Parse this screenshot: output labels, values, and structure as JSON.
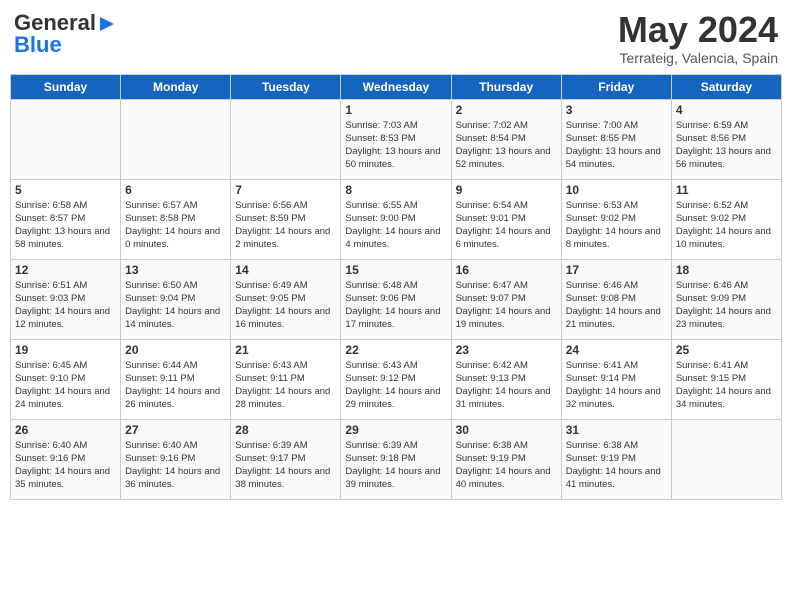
{
  "header": {
    "logo_general": "General",
    "logo_blue": "Blue",
    "month_title": "May 2024",
    "location": "Terrateig, Valencia, Spain"
  },
  "days_of_week": [
    "Sunday",
    "Monday",
    "Tuesday",
    "Wednesday",
    "Thursday",
    "Friday",
    "Saturday"
  ],
  "weeks": [
    [
      {
        "day": "",
        "sunrise": "",
        "sunset": "",
        "daylight": ""
      },
      {
        "day": "",
        "sunrise": "",
        "sunset": "",
        "daylight": ""
      },
      {
        "day": "",
        "sunrise": "",
        "sunset": "",
        "daylight": ""
      },
      {
        "day": "1",
        "sunrise": "Sunrise: 7:03 AM",
        "sunset": "Sunset: 8:53 PM",
        "daylight": "Daylight: 13 hours and 50 minutes."
      },
      {
        "day": "2",
        "sunrise": "Sunrise: 7:02 AM",
        "sunset": "Sunset: 8:54 PM",
        "daylight": "Daylight: 13 hours and 52 minutes."
      },
      {
        "day": "3",
        "sunrise": "Sunrise: 7:00 AM",
        "sunset": "Sunset: 8:55 PM",
        "daylight": "Daylight: 13 hours and 54 minutes."
      },
      {
        "day": "4",
        "sunrise": "Sunrise: 6:59 AM",
        "sunset": "Sunset: 8:56 PM",
        "daylight": "Daylight: 13 hours and 56 minutes."
      }
    ],
    [
      {
        "day": "5",
        "sunrise": "Sunrise: 6:58 AM",
        "sunset": "Sunset: 8:57 PM",
        "daylight": "Daylight: 13 hours and 58 minutes."
      },
      {
        "day": "6",
        "sunrise": "Sunrise: 6:57 AM",
        "sunset": "Sunset: 8:58 PM",
        "daylight": "Daylight: 14 hours and 0 minutes."
      },
      {
        "day": "7",
        "sunrise": "Sunrise: 6:56 AM",
        "sunset": "Sunset: 8:59 PM",
        "daylight": "Daylight: 14 hours and 2 minutes."
      },
      {
        "day": "8",
        "sunrise": "Sunrise: 6:55 AM",
        "sunset": "Sunset: 9:00 PM",
        "daylight": "Daylight: 14 hours and 4 minutes."
      },
      {
        "day": "9",
        "sunrise": "Sunrise: 6:54 AM",
        "sunset": "Sunset: 9:01 PM",
        "daylight": "Daylight: 14 hours and 6 minutes."
      },
      {
        "day": "10",
        "sunrise": "Sunrise: 6:53 AM",
        "sunset": "Sunset: 9:02 PM",
        "daylight": "Daylight: 14 hours and 8 minutes."
      },
      {
        "day": "11",
        "sunrise": "Sunrise: 6:52 AM",
        "sunset": "Sunset: 9:02 PM",
        "daylight": "Daylight: 14 hours and 10 minutes."
      }
    ],
    [
      {
        "day": "12",
        "sunrise": "Sunrise: 6:51 AM",
        "sunset": "Sunset: 9:03 PM",
        "daylight": "Daylight: 14 hours and 12 minutes."
      },
      {
        "day": "13",
        "sunrise": "Sunrise: 6:50 AM",
        "sunset": "Sunset: 9:04 PM",
        "daylight": "Daylight: 14 hours and 14 minutes."
      },
      {
        "day": "14",
        "sunrise": "Sunrise: 6:49 AM",
        "sunset": "Sunset: 9:05 PM",
        "daylight": "Daylight: 14 hours and 16 minutes."
      },
      {
        "day": "15",
        "sunrise": "Sunrise: 6:48 AM",
        "sunset": "Sunset: 9:06 PM",
        "daylight": "Daylight: 14 hours and 17 minutes."
      },
      {
        "day": "16",
        "sunrise": "Sunrise: 6:47 AM",
        "sunset": "Sunset: 9:07 PM",
        "daylight": "Daylight: 14 hours and 19 minutes."
      },
      {
        "day": "17",
        "sunrise": "Sunrise: 6:46 AM",
        "sunset": "Sunset: 9:08 PM",
        "daylight": "Daylight: 14 hours and 21 minutes."
      },
      {
        "day": "18",
        "sunrise": "Sunrise: 6:46 AM",
        "sunset": "Sunset: 9:09 PM",
        "daylight": "Daylight: 14 hours and 23 minutes."
      }
    ],
    [
      {
        "day": "19",
        "sunrise": "Sunrise: 6:45 AM",
        "sunset": "Sunset: 9:10 PM",
        "daylight": "Daylight: 14 hours and 24 minutes."
      },
      {
        "day": "20",
        "sunrise": "Sunrise: 6:44 AM",
        "sunset": "Sunset: 9:11 PM",
        "daylight": "Daylight: 14 hours and 26 minutes."
      },
      {
        "day": "21",
        "sunrise": "Sunrise: 6:43 AM",
        "sunset": "Sunset: 9:11 PM",
        "daylight": "Daylight: 14 hours and 28 minutes."
      },
      {
        "day": "22",
        "sunrise": "Sunrise: 6:43 AM",
        "sunset": "Sunset: 9:12 PM",
        "daylight": "Daylight: 14 hours and 29 minutes."
      },
      {
        "day": "23",
        "sunrise": "Sunrise: 6:42 AM",
        "sunset": "Sunset: 9:13 PM",
        "daylight": "Daylight: 14 hours and 31 minutes."
      },
      {
        "day": "24",
        "sunrise": "Sunrise: 6:41 AM",
        "sunset": "Sunset: 9:14 PM",
        "daylight": "Daylight: 14 hours and 32 minutes."
      },
      {
        "day": "25",
        "sunrise": "Sunrise: 6:41 AM",
        "sunset": "Sunset: 9:15 PM",
        "daylight": "Daylight: 14 hours and 34 minutes."
      }
    ],
    [
      {
        "day": "26",
        "sunrise": "Sunrise: 6:40 AM",
        "sunset": "Sunset: 9:16 PM",
        "daylight": "Daylight: 14 hours and 35 minutes."
      },
      {
        "day": "27",
        "sunrise": "Sunrise: 6:40 AM",
        "sunset": "Sunset: 9:16 PM",
        "daylight": "Daylight: 14 hours and 36 minutes."
      },
      {
        "day": "28",
        "sunrise": "Sunrise: 6:39 AM",
        "sunset": "Sunset: 9:17 PM",
        "daylight": "Daylight: 14 hours and 38 minutes."
      },
      {
        "day": "29",
        "sunrise": "Sunrise: 6:39 AM",
        "sunset": "Sunset: 9:18 PM",
        "daylight": "Daylight: 14 hours and 39 minutes."
      },
      {
        "day": "30",
        "sunrise": "Sunrise: 6:38 AM",
        "sunset": "Sunset: 9:19 PM",
        "daylight": "Daylight: 14 hours and 40 minutes."
      },
      {
        "day": "31",
        "sunrise": "Sunrise: 6:38 AM",
        "sunset": "Sunset: 9:19 PM",
        "daylight": "Daylight: 14 hours and 41 minutes."
      },
      {
        "day": "",
        "sunrise": "",
        "sunset": "",
        "daylight": ""
      }
    ]
  ]
}
